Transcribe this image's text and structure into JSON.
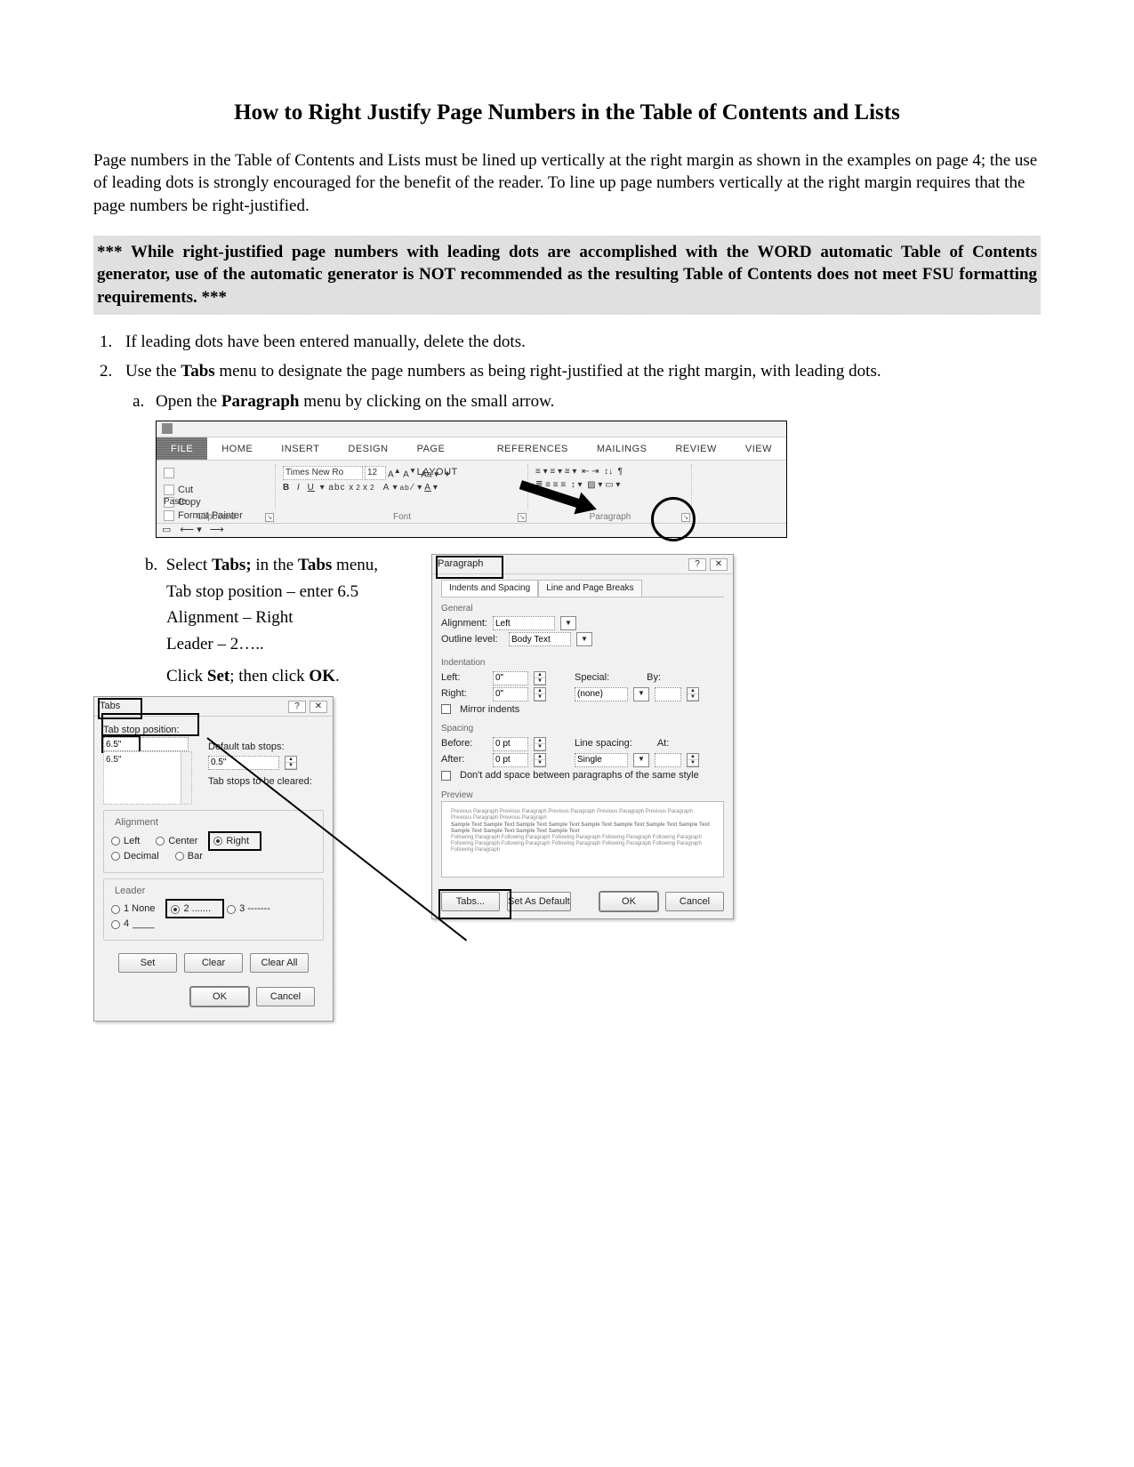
{
  "title": "How to Right Justify Page Numbers in the Table of Contents and Lists",
  "intro": "Page numbers in the Table of Contents and Lists must be lined up vertically at the right margin as shown in the examples on page 4; the use of leading dots is strongly encouraged for the benefit of the reader. To line up page numbers vertically at the right margin requires that the page numbers be right-justified.",
  "warning": "*** While right-justified page numbers with leading dots are accomplished with the WORD automatic Table of Contents generator, use of the automatic generator is NOT recommended as the resulting Table of Contents does not meet FSU formatting requirements. ***",
  "steps": {
    "s1": "If leading dots have been entered manually, delete the dots.",
    "s2a": "Use the ",
    "s2b": "Tabs",
    "s2c": " menu to designate the page numbers as being right-justified at the right margin, with leading dots.",
    "s2sub_a_a": "Open the ",
    "s2sub_a_b": "Paragraph",
    "s2sub_a_c": " menu by clicking on the small arrow.",
    "s2sub_b_a": "Select ",
    "s2sub_b_b": "Tabs;",
    "s2sub_b_c": " in the ",
    "s2sub_b_d": "Tabs",
    "s2sub_b_e": " menu,",
    "sub_b_l1": "Tab stop position – enter 6.5",
    "sub_b_l2": "Alignment – Right",
    "sub_b_l3": "Leader – 2…..",
    "sub_b_click_a": "Click ",
    "sub_b_click_b": "Set",
    "sub_b_click_c": "; then click ",
    "sub_b_click_d": "OK",
    "sub_b_click_e": "."
  },
  "ribbon": {
    "tabs": {
      "file": "FILE",
      "home": "HOME",
      "insert": "INSERT",
      "design": "DESIGN",
      "pagelayout": "PAGE LAYOUT",
      "references": "REFERENCES",
      "mailings": "MAILINGS",
      "review": "REVIEW",
      "view": "VIEW"
    },
    "clipboard": {
      "paste": "Paste",
      "cut": "Cut",
      "copy": "Copy",
      "painter": "Format Painter",
      "label": "Clipboard"
    },
    "font": {
      "name": "Times New Ro",
      "size": "12",
      "label": "Font"
    },
    "paragraph": {
      "label": "Paragraph"
    }
  },
  "tabs_dialog": {
    "title": "Tabs",
    "tab_stop_position_label": "Tab stop position:",
    "tab_stop_value": "6.5\"",
    "list_item": "6.5\"",
    "default_tab_stops_label": "Default tab stops:",
    "default_tab_stops_value": "0.5\"",
    "to_be_cleared": "Tab stops to be cleared:",
    "alignment": "Alignment",
    "align_left": "Left",
    "align_center": "Center",
    "align_right": "Right",
    "align_decimal": "Decimal",
    "align_bar": "Bar",
    "leader": "Leader",
    "leader1": "1 None",
    "leader2": "2 .......",
    "leader3": "3 -------",
    "leader4": "4",
    "set": "Set",
    "clear": "Clear",
    "clear_all": "Clear All",
    "ok": "OK",
    "cancel": "Cancel"
  },
  "para_dialog": {
    "title": "Paragraph",
    "tab1": "Indents and Spacing",
    "tab2": "Line and Page Breaks",
    "general": "General",
    "alignment_label": "Alignment:",
    "alignment_value": "Left",
    "outline_label": "Outline level:",
    "outline_value": "Body Text",
    "indentation": "Indentation",
    "left_label": "Left:",
    "left_value": "0\"",
    "right_label": "Right:",
    "right_value": "0\"",
    "special_label": "Special:",
    "special_value": "(none)",
    "by_label": "By:",
    "mirror": "Mirror indents",
    "spacing": "Spacing",
    "before_label": "Before:",
    "before_value": "0 pt",
    "after_label": "After:",
    "after_value": "0 pt",
    "line_spacing_label": "Line spacing:",
    "line_spacing_value": "Single",
    "at_label": "At:",
    "dont_add": "Don't add space between paragraphs of the same style",
    "preview": "Preview",
    "tabs_btn": "Tabs...",
    "default_btn": "Set As Default",
    "ok": "OK",
    "cancel": "Cancel"
  }
}
